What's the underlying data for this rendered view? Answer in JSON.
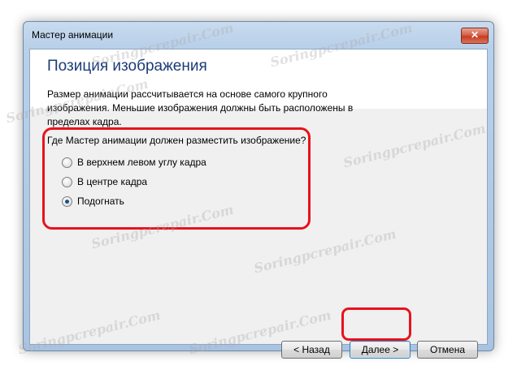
{
  "window": {
    "title": "Мастер анимации",
    "close_glyph": "✕"
  },
  "page": {
    "heading": "Позиция изображения",
    "description": "Размер анимации рассчитывается на основе самого крупного изображения. Меньшие изображения должны быть расположены в пределах кадра.",
    "question": "Где Мастер анимации должен разместить изображение?",
    "options": [
      {
        "label": "В верхнем левом углу кадра",
        "checked": false
      },
      {
        "label": "В центре кадра",
        "checked": false
      },
      {
        "label": "Подогнать",
        "checked": true
      }
    ]
  },
  "buttons": {
    "back": "< Назад",
    "next": "Далее >",
    "cancel": "Отмена"
  },
  "watermark": "Soringpcrepair.Com",
  "colors": {
    "annotation": "#e8121c",
    "heading": "#1c3c76"
  }
}
